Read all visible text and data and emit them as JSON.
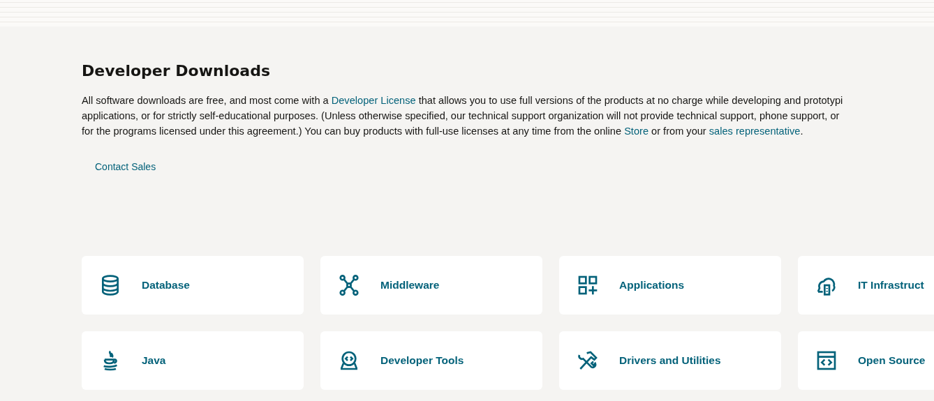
{
  "heading": "Developer Downloads",
  "intro_lines": [
    [
      {
        "text": "All software downloads are free, and most come with a "
      },
      {
        "link": "Developer License"
      },
      {
        "text": " that allows you to use full versions of the products at no charge while developing and prototypi"
      }
    ],
    [
      {
        "text": "applications, or for strictly self-educational purposes. (Unless otherwise specified, our technical support organization will not provide technical support, phone support, or"
      }
    ],
    [
      {
        "text": "for the programs licensed under this agreement.) You can buy products with full-use licenses at any time from the online "
      },
      {
        "link": "Store"
      },
      {
        "text": " or from your "
      },
      {
        "link": "sales representative"
      },
      {
        "text": "."
      }
    ]
  ],
  "contact_link": "Contact Sales",
  "categories": [
    {
      "kind": "database",
      "label": "Database"
    },
    {
      "kind": "network",
      "label": "Middleware"
    },
    {
      "kind": "grid",
      "label": "Applications"
    },
    {
      "kind": "cloud",
      "label": "IT Infrastruct"
    },
    {
      "kind": "java",
      "label": "Java"
    },
    {
      "kind": "devtools",
      "label": "Developer Tools"
    },
    {
      "kind": "tools",
      "label": "Drivers and Utilities"
    },
    {
      "kind": "code",
      "label": "Open Source"
    }
  ]
}
